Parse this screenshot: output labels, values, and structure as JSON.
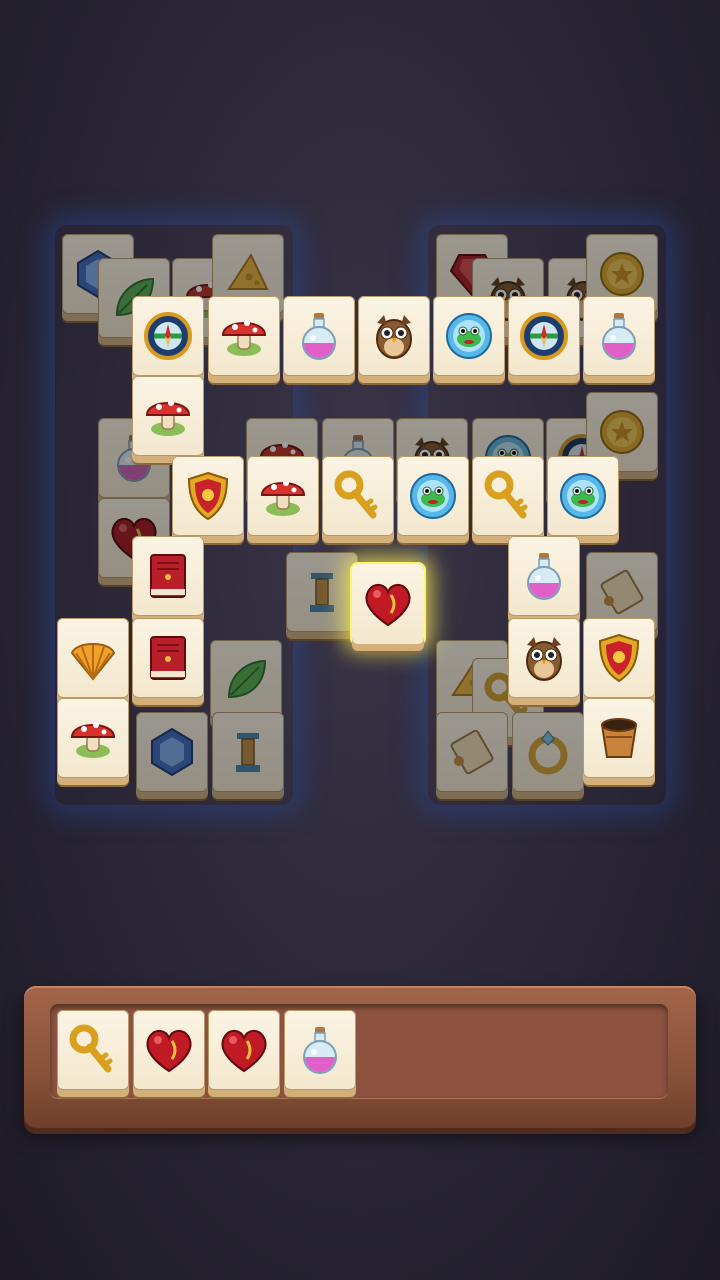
{
  "game": {
    "board_tiles": [
      {
        "icon": "gem-blue-icon",
        "dim": true
      },
      {
        "icon": "leaf-icon",
        "dim": true
      },
      {
        "icon": "mushroom-icon",
        "dim": true
      },
      {
        "icon": "cheese-icon",
        "dim": true
      },
      {
        "icon": "ruby-icon",
        "dim": true
      },
      {
        "icon": "owl-icon",
        "dim": true
      },
      {
        "icon": "owl-icon",
        "dim": true
      },
      {
        "icon": "coin-icon",
        "dim": true
      },
      {
        "icon": "compass-icon",
        "dim": false
      },
      {
        "icon": "mushroom-icon",
        "dim": false
      },
      {
        "icon": "potion-icon",
        "dim": false
      },
      {
        "icon": "owl-icon",
        "dim": false
      },
      {
        "icon": "frog-orb-icon",
        "dim": false
      },
      {
        "icon": "compass-icon",
        "dim": false
      },
      {
        "icon": "potion-icon",
        "dim": false
      },
      {
        "icon": "mushroom-icon",
        "dim": false
      },
      {
        "icon": "potion-icon",
        "dim": true
      },
      {
        "icon": "mushroom-icon",
        "dim": true
      },
      {
        "icon": "potion-icon",
        "dim": true
      },
      {
        "icon": "owl-icon",
        "dim": true
      },
      {
        "icon": "frog-orb-icon",
        "dim": true
      },
      {
        "icon": "compass-icon",
        "dim": true
      },
      {
        "icon": "coin-icon",
        "dim": true
      },
      {
        "icon": "shield-icon",
        "dim": false
      },
      {
        "icon": "mushroom-icon",
        "dim": false
      },
      {
        "icon": "key-icon",
        "dim": false
      },
      {
        "icon": "frog-orb-icon",
        "dim": false
      },
      {
        "icon": "key-icon",
        "dim": false
      },
      {
        "icon": "frog-orb-icon",
        "dim": false
      },
      {
        "icon": "heart-icon",
        "dim": true
      },
      {
        "icon": "book-icon",
        "dim": false
      },
      {
        "icon": "heart-icon",
        "dim": false,
        "selected": true
      },
      {
        "icon": "potion-icon",
        "dim": false
      },
      {
        "icon": "scroll-icon",
        "dim": true
      },
      {
        "icon": "pillar-icon",
        "dim": true
      },
      {
        "icon": "shell-icon",
        "dim": false
      },
      {
        "icon": "book-icon",
        "dim": false
      },
      {
        "icon": "leaf-icon",
        "dim": true
      },
      {
        "icon": "cheese-icon",
        "dim": true
      },
      {
        "icon": "key-icon",
        "dim": true
      },
      {
        "icon": "owl-icon",
        "dim": false
      },
      {
        "icon": "shield-icon",
        "dim": false
      },
      {
        "icon": "mushroom-icon",
        "dim": false
      },
      {
        "icon": "gem-blue-icon",
        "dim": true
      },
      {
        "icon": "pillar-icon",
        "dim": true
      },
      {
        "icon": "scroll-icon",
        "dim": true
      },
      {
        "icon": "ring-icon",
        "dim": true
      },
      {
        "icon": "bucket-icon",
        "dim": false
      }
    ],
    "tray": {
      "capacity": 7,
      "slots": [
        "key-icon",
        "heart-icon",
        "heart-icon",
        "potion-icon"
      ]
    }
  }
}
